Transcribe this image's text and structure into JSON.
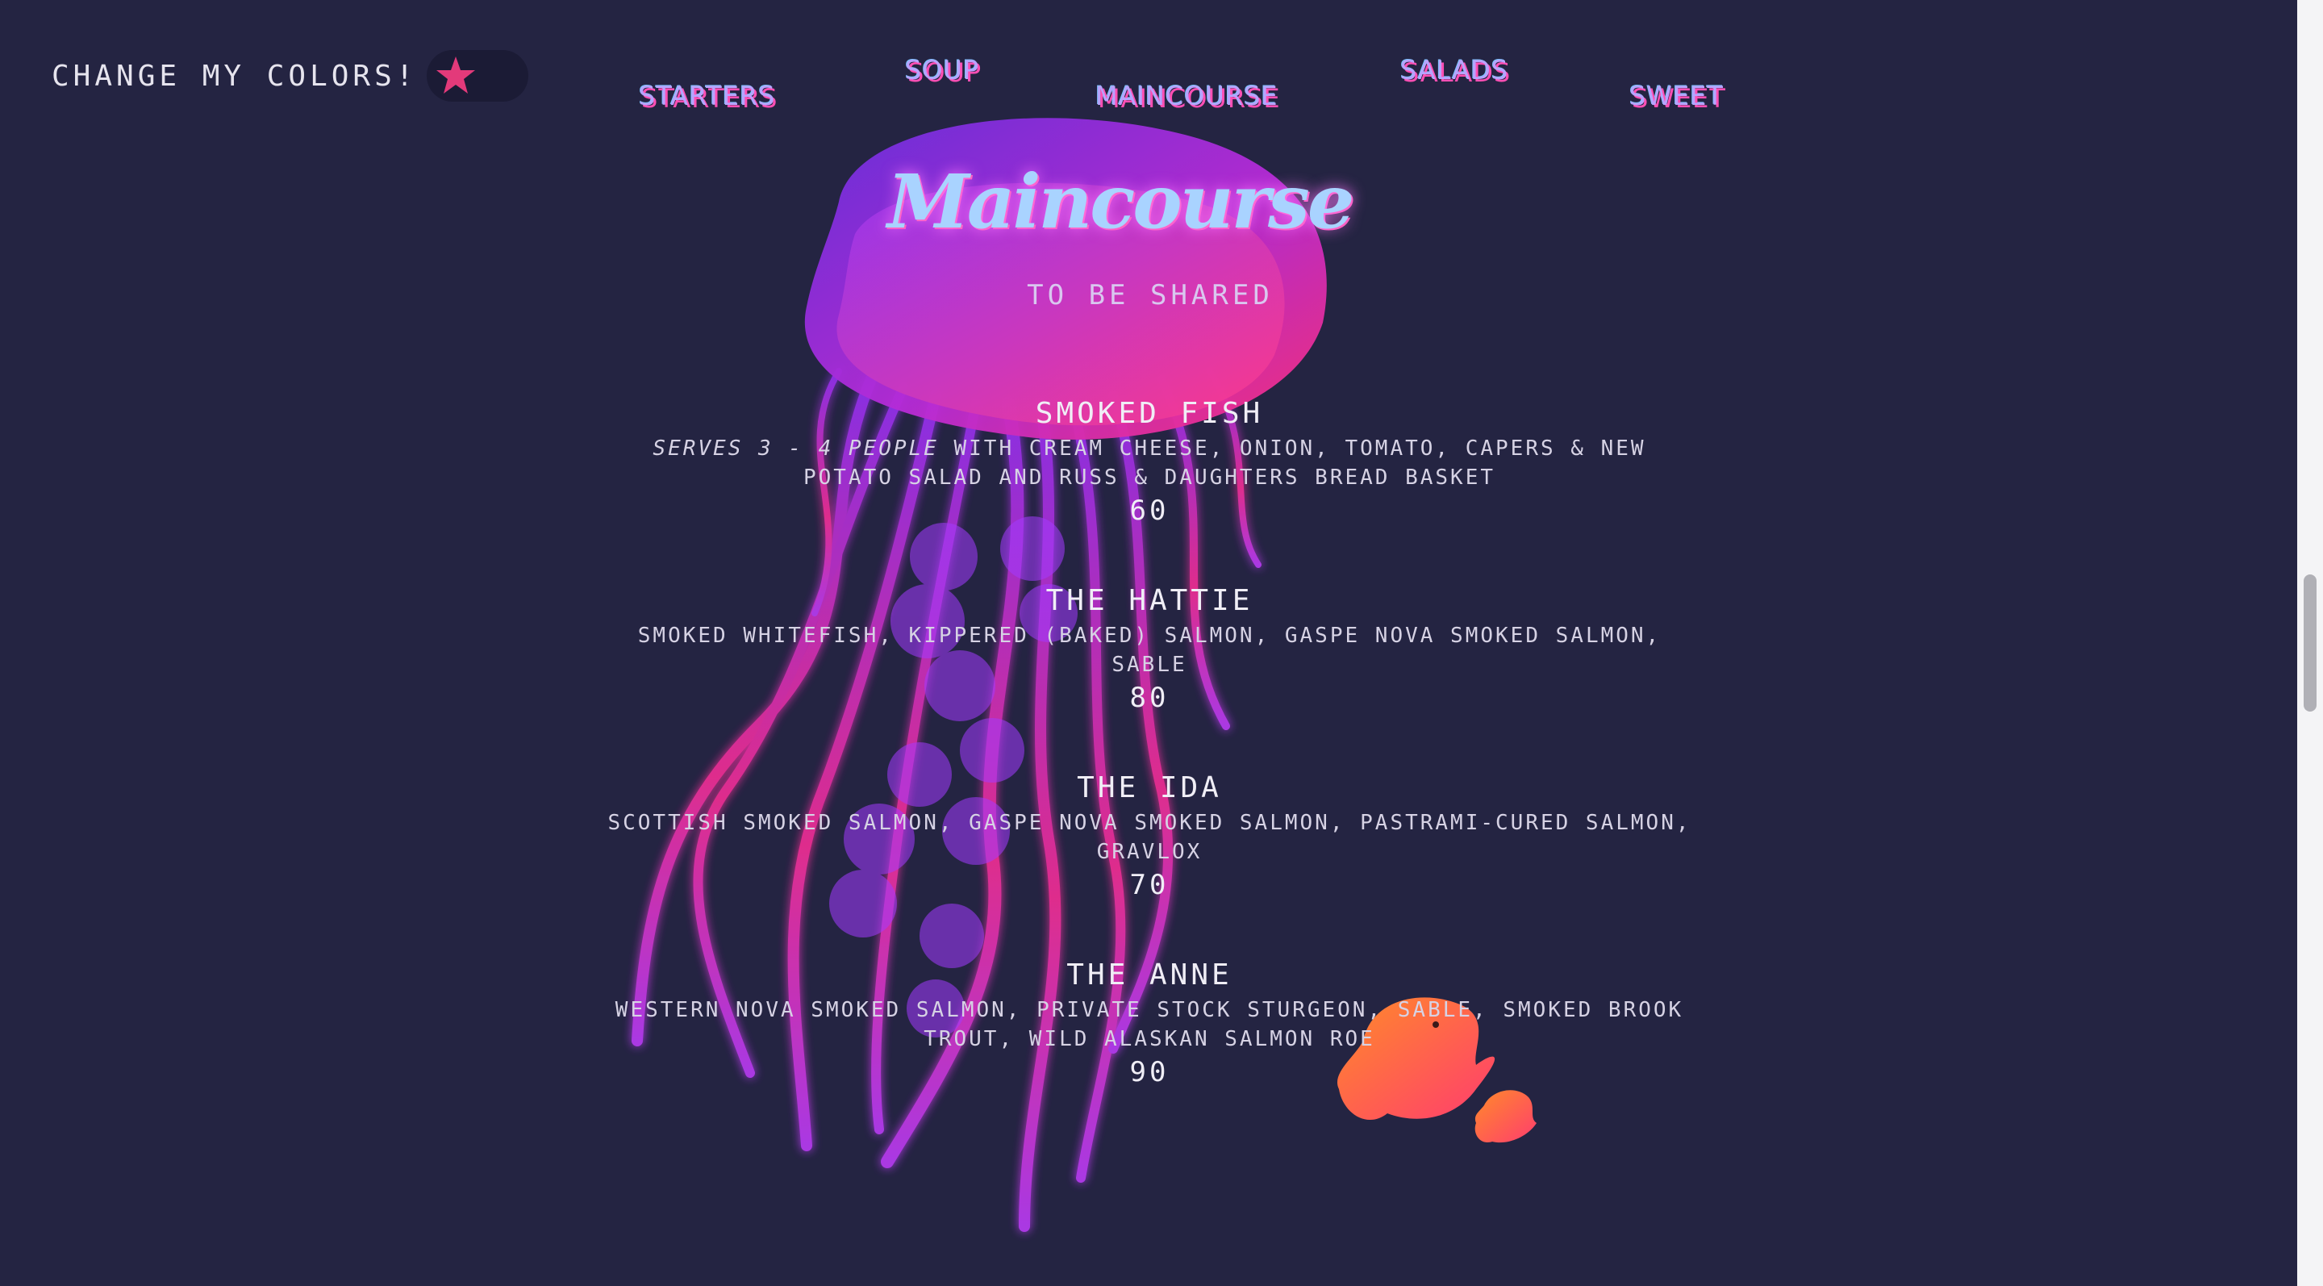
{
  "toggle": {
    "label": "Change my colors!",
    "icon": "starfish-icon"
  },
  "nav": {
    "items": [
      {
        "label": "Starters"
      },
      {
        "label": "Soup"
      },
      {
        "label": "Maincourse"
      },
      {
        "label": "Salads"
      },
      {
        "label": "Sweet"
      }
    ]
  },
  "section": {
    "title": "Maincourse",
    "subtitle": "To be shared"
  },
  "menu": {
    "items": [
      {
        "name": "Smoked Fish",
        "note": "Serves 3 - 4 people",
        "desc": " with cream cheese, onion, tomato, capers & new potato salad and Russ & Daughters bread basket",
        "price": "60"
      },
      {
        "name": "The Hattie",
        "note": "",
        "desc": "Smoked whitefish, kippered (baked) salmon, Gaspe Nova smoked salmon, sable",
        "price": "80"
      },
      {
        "name": "The Ida",
        "note": "",
        "desc": "Scottish smoked salmon, Gaspe Nova smoked salmon, pastrami-cured salmon, gravlox",
        "price": "70"
      },
      {
        "name": "The Anne",
        "note": "",
        "desc": "Western Nova smoked salmon, private stock sturgeon, sable, smoked brook trout, wild Alaskan salmon roe",
        "price": "90"
      }
    ]
  },
  "colors": {
    "background": "#242442",
    "accent_pink": "#ff3d8f",
    "accent_purple": "#8a2be2",
    "nav_text": "#b9a2ff",
    "title_text": "#a9d3ff",
    "fish_orange": "#ff6a2e"
  },
  "decor": {
    "jellyfish": "jellyfish-illustration",
    "fish": "clownfish-illustration"
  }
}
